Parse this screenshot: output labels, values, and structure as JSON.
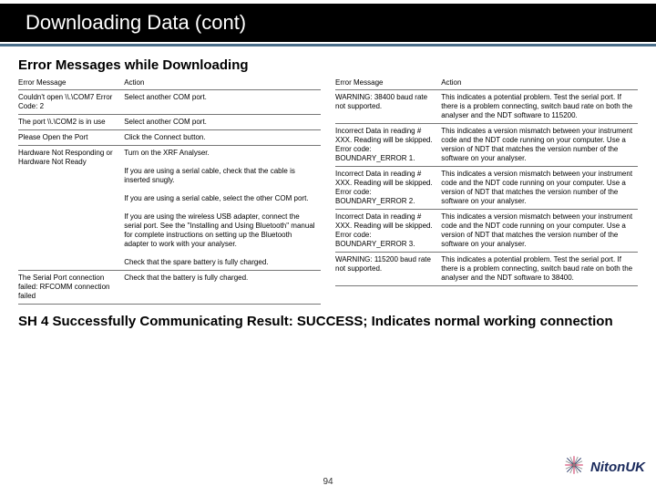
{
  "title": "Downloading Data (cont)",
  "section": "Error Messages while Downloading",
  "headers": {
    "msg": "Error Message",
    "action": "Action"
  },
  "left_rows": [
    {
      "msg": "Couldn't open \\\\.\\COM7 Error Code: 2",
      "action": "Select another COM port."
    },
    {
      "msg": "The port \\\\.\\COM2 is in use",
      "action": "Select another COM port."
    },
    {
      "msg": "Please Open the Port",
      "action": "Click the Connect button."
    },
    {
      "msg": "Hardware Not Responding or Hardware Not Ready",
      "action": "Turn on the XRF Analyser.\n\nIf you are using a serial cable, check that the cable is inserted snugly.\n\nIf you are using a serial cable, select the other COM port.\n\nIf you are using the wireless USB adapter, connect the serial port. See the \"Installing and Using Bluetooth\" manual for complete instructions on setting up the Bluetooth adapter to work with your analyser.\n\nCheck that the spare battery is fully charged."
    },
    {
      "msg": "The Serial Port connection failed: RFCOMM connection failed",
      "action": "Check that the battery is fully charged."
    }
  ],
  "right_rows": [
    {
      "msg": "WARNING: 38400 baud rate not supported.",
      "action": "This indicates a potential problem. Test the serial port. If there is a problem connecting, switch baud rate on both the analyser and the NDT software to 115200."
    },
    {
      "msg": "Incorrect Data in reading # XXX. Reading will be skipped. Error code: BOUNDARY_ERROR 1.",
      "action": "This indicates a version mismatch between your instrument code and the NDT code running on your computer. Use a version of NDT that matches the version number of the software on your analyser."
    },
    {
      "msg": "Incorrect Data in reading # XXX. Reading will be skipped. Error code: BOUNDARY_ERROR 2.",
      "action": "This indicates a version mismatch between your instrument code and the NDT code running on your computer. Use a version of NDT that matches the version number of the software on your analyser."
    },
    {
      "msg": "Incorrect Data in reading # XXX. Reading will be skipped. Error code: BOUNDARY_ERROR 3.",
      "action": "This indicates a version mismatch between your instrument code and the NDT code running on your computer. Use a version of NDT that matches the version number of the software on your analyser."
    },
    {
      "msg": "WARNING: 115200 baud rate not supported.",
      "action": "This indicates a potential problem. Test the serial port. If there is a problem connecting, switch baud rate on both the analyser and the NDT software to 38400."
    }
  ],
  "success_text": "SH 4 Successfully Communicating Result: SUCCESS; Indicates normal working connection",
  "page_number": "94",
  "logo_text": "NitonUK"
}
